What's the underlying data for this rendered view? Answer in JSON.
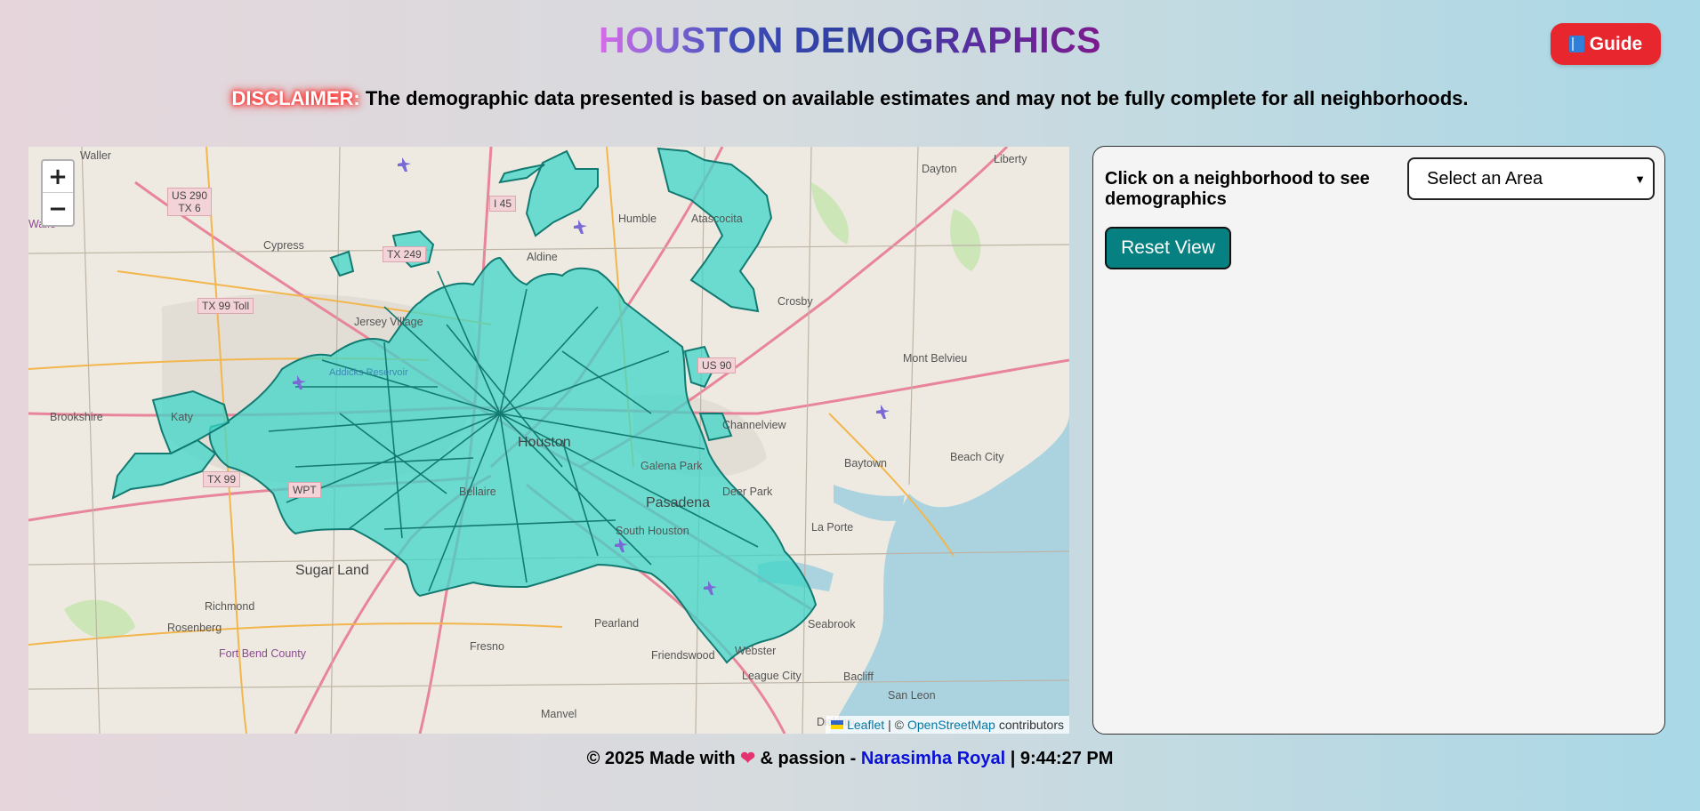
{
  "header": {
    "title": "HOUSTON DEMOGRAPHICS",
    "guide_label": "Guide",
    "guide_icon": "book-icon"
  },
  "disclaimer": {
    "label": "DISCLAIMER:",
    "text": "The demographic data presented is based on available estimates and may not be fully complete for all neighborhoods."
  },
  "map": {
    "zoom_in": "+",
    "zoom_out": "−",
    "attribution": {
      "leaflet": "Leaflet",
      "separator": "| ©",
      "osm": "OpenStreetMap",
      "contributors": "contributors"
    },
    "places": [
      "Waller",
      "Cypress",
      "Jersey Village",
      "Aldine",
      "Humble",
      "Atascocita",
      "Dayton",
      "Liberty",
      "Crosby",
      "Mont Belvieu",
      "Brookshire",
      "Katy",
      "Houston",
      "Channelview",
      "Baytown",
      "Beach City",
      "Galena Park",
      "Pasadena",
      "Deer Park",
      "South Houston",
      "La Porte",
      "Bellaire",
      "Sugar Land",
      "Richmond",
      "Rosenberg",
      "Fort Bend County",
      "Fresno",
      "Pearland",
      "Friendswood",
      "Webster",
      "Seabrook",
      "League City",
      "Bacliff",
      "San Leon",
      "Manvel",
      "Waller County",
      "Addicks Reservoir",
      "Dickinson"
    ],
    "highlight_color": "#3fd6c8"
  },
  "panel": {
    "prompt": "Click on a neighborhood to see demographics",
    "select_value": "Select an Area",
    "reset_label": "Reset View"
  },
  "footer": {
    "prefix": "© 2025 Made with",
    "middle": "& passion -",
    "author": "Narasimha Royal",
    "time": "| 9:44:27 PM"
  }
}
